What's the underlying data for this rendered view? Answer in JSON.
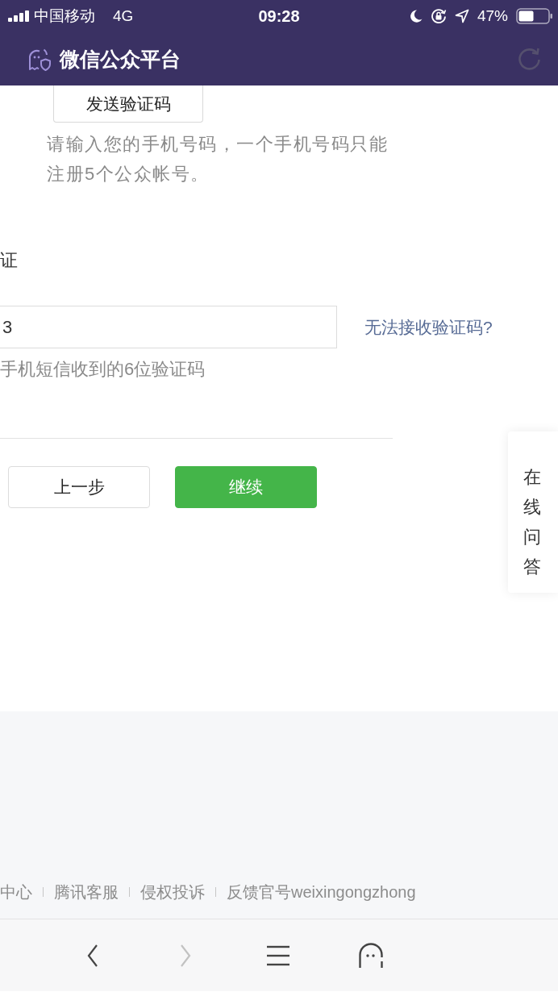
{
  "status_bar": {
    "carrier": "中国移动",
    "network": "4G",
    "time": "09:28",
    "battery": "47%"
  },
  "header": {
    "title": "微信公众平台"
  },
  "form": {
    "send_code_button": "发送验证码",
    "phone_hint": "请输入您的手机号码，一个手机号码只能注册5个公众帐号。",
    "code_label": "证",
    "code_input": {
      "value": "3"
    },
    "cannot_receive_link": "无法接收验证码?",
    "code_hint": "手机短信收到的6位验证码",
    "buttons": [
      {
        "label": "上一步",
        "kind": "secondary"
      },
      {
        "label": "继续",
        "kind": "primary"
      }
    ]
  },
  "side_panel": {
    "label": "在线问答"
  },
  "footer": {
    "links": [
      "中心",
      "腾讯客服",
      "侵权投诉",
      "反馈官号weixingongzhong"
    ]
  },
  "browser_toolbar": {
    "buttons": [
      {
        "kind": "back",
        "disabled": false
      },
      {
        "kind": "forward",
        "disabled": true
      },
      {
        "kind": "menu",
        "disabled": false
      },
      {
        "kind": "ghost",
        "disabled": false
      }
    ]
  }
}
